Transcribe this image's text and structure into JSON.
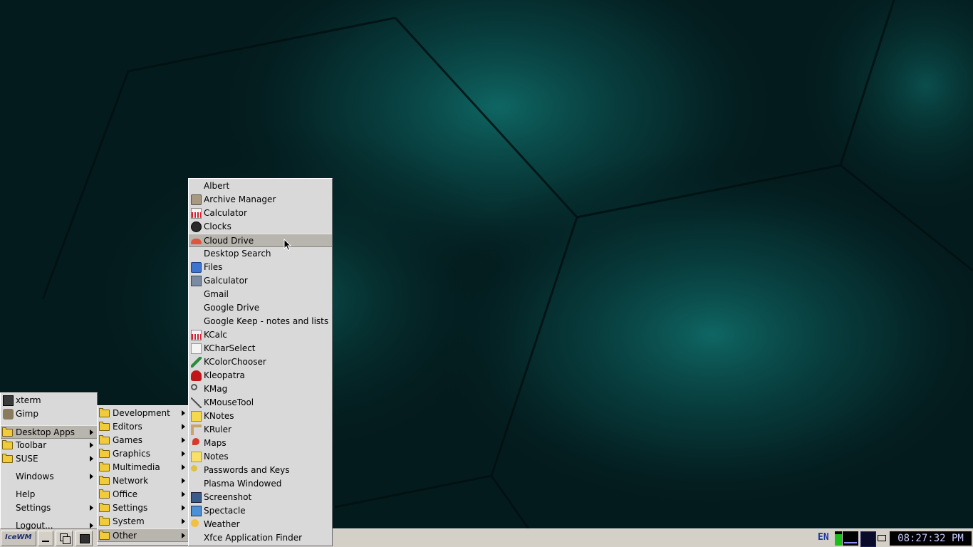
{
  "root_menu": {
    "items": [
      {
        "label": "xterm",
        "icon": "terminal-icon"
      },
      {
        "label": "Gimp",
        "icon": "gimp-icon"
      },
      {
        "label": "Desktop Apps",
        "icon": "folder-icon",
        "submenu": true,
        "active": true
      },
      {
        "label": "Toolbar",
        "icon": "folder-icon",
        "submenu": true
      },
      {
        "label": "SUSE",
        "icon": "folder-icon",
        "submenu": true
      },
      {
        "label": "Windows",
        "submenu": true
      },
      {
        "label": "Help"
      },
      {
        "label": "Settings",
        "submenu": true
      },
      {
        "label": "Logout...",
        "submenu": true
      }
    ]
  },
  "desktop_apps_menu": {
    "items": [
      {
        "label": "Development"
      },
      {
        "label": "Editors"
      },
      {
        "label": "Games"
      },
      {
        "label": "Graphics"
      },
      {
        "label": "Multimedia"
      },
      {
        "label": "Network"
      },
      {
        "label": "Office"
      },
      {
        "label": "Settings"
      },
      {
        "label": "System"
      },
      {
        "label": "Other",
        "active": true
      }
    ]
  },
  "other_menu": {
    "items": [
      {
        "label": "Albert",
        "icon": ""
      },
      {
        "label": "Archive Manager",
        "icon": "archive-icon"
      },
      {
        "label": "Calculator",
        "icon": "calculator-icon"
      },
      {
        "label": "Clocks",
        "icon": "clock-icon"
      },
      {
        "label": "Cloud Drive",
        "icon": "cloud-icon",
        "active": true
      },
      {
        "label": "Desktop Search",
        "icon": ""
      },
      {
        "label": "Files",
        "icon": "files-icon"
      },
      {
        "label": "Galculator",
        "icon": "galculator-icon"
      },
      {
        "label": "Gmail",
        "icon": ""
      },
      {
        "label": "Google Drive",
        "icon": ""
      },
      {
        "label": "Google Keep - notes and lists",
        "icon": ""
      },
      {
        "label": "KCalc",
        "icon": "kcalc-icon"
      },
      {
        "label": "KCharSelect",
        "icon": "charselect-icon"
      },
      {
        "label": "KColorChooser",
        "icon": "color-picker-icon"
      },
      {
        "label": "Kleopatra",
        "icon": "kleopatra-icon"
      },
      {
        "label": "KMag",
        "icon": "magnifier-icon"
      },
      {
        "label": "KMouseTool",
        "icon": "mouse-tool-icon"
      },
      {
        "label": "KNotes",
        "icon": "notes-icon"
      },
      {
        "label": "KRuler",
        "icon": "ruler-icon"
      },
      {
        "label": "Maps",
        "icon": "map-pin-icon"
      },
      {
        "label": "Notes",
        "icon": "sticky-note-icon"
      },
      {
        "label": "Passwords and Keys",
        "icon": "key-icon"
      },
      {
        "label": "Plasma Windowed",
        "icon": ""
      },
      {
        "label": "Screenshot",
        "icon": "screenshot-icon"
      },
      {
        "label": "Spectacle",
        "icon": "spectacle-icon"
      },
      {
        "label": "Weather",
        "icon": "weather-icon"
      },
      {
        "label": "Xfce Application Finder",
        "icon": ""
      }
    ]
  },
  "taskbar": {
    "start_label": "IceWM",
    "language": "EN",
    "clock": "08:27:32 PM"
  },
  "colors": {
    "menu_bg": "#d9d9d9",
    "active_item": "#b8b4ae",
    "wallpaper_base": "#031a1c",
    "wallpaper_glow": "#0e5e5c",
    "clock_bg": "#000000",
    "clock_fg": "#c8c8ff"
  }
}
